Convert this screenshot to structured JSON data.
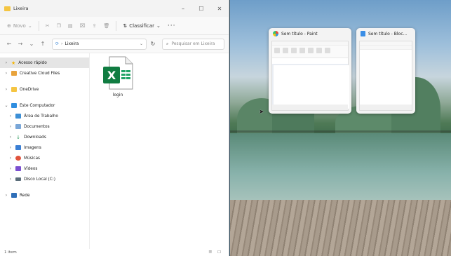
{
  "explorer": {
    "title": "Lixeira",
    "controls": {
      "minimize": "–",
      "maximize": "☐",
      "close": "✕"
    },
    "toolbar": {
      "new_label": "Novo",
      "sort_label": "Classificar",
      "more_label": "···"
    },
    "nav": {
      "path": "Lixeira",
      "search_placeholder": "Pesquisar em Lixeira"
    },
    "sidebar": {
      "items": [
        {
          "label": "Acesso rápido",
          "color": "#f5b400"
        },
        {
          "label": "Creative Cloud Files",
          "color": "#e8a33c"
        },
        {
          "label": "OneDrive",
          "color": "#f5c542"
        },
        {
          "label": "Este Computador",
          "color": "#2f8ee0"
        },
        {
          "label": "Área de Trabalho",
          "color": "#3c8fd6"
        },
        {
          "label": "Documentos",
          "color": "#7aa7d8"
        },
        {
          "label": "Downloads",
          "color": "#2c9b5d"
        },
        {
          "label": "Imagens",
          "color": "#3b7fd4"
        },
        {
          "label": "Músicas",
          "color": "#e0533c"
        },
        {
          "label": "Vídeos",
          "color": "#7b4fd0"
        },
        {
          "label": "Disco Local (C:)",
          "color": "#5b6d7a"
        },
        {
          "label": "Rede",
          "color": "#2f6fb8"
        }
      ]
    },
    "files": [
      {
        "name": "login",
        "type": "excel",
        "badge": "X"
      }
    ],
    "status": {
      "text": "1 item",
      "views": "☰ ☐"
    }
  },
  "snap": {
    "paint_title": "Sem título - Paint",
    "notepad_title": "Sem título - Bloc..."
  }
}
